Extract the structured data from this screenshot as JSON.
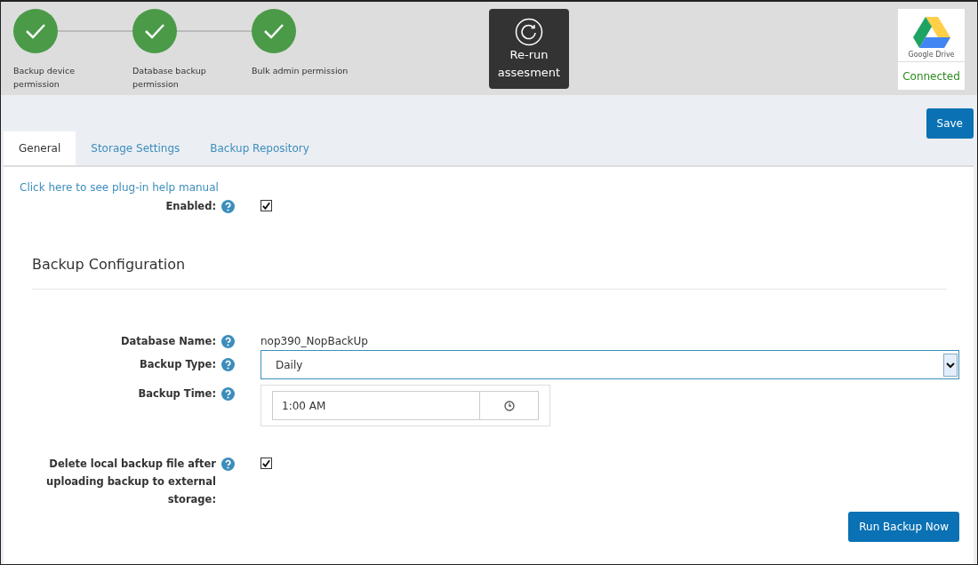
{
  "steps": [
    {
      "label": "Backup device permission",
      "completed": true
    },
    {
      "label": "Database backup permission",
      "completed": true
    },
    {
      "label": "Bulk admin permission",
      "completed": true
    }
  ],
  "rerun_button": {
    "label": "Re-run assesment"
  },
  "storage_card": {
    "name": "Google Drive",
    "status": "Connected"
  },
  "save_button": {
    "label": "Save"
  },
  "tabs": [
    {
      "label": "General",
      "selected": true
    },
    {
      "label": "Storage Settings",
      "selected": false
    },
    {
      "label": "Backup Repository",
      "selected": false
    }
  ],
  "help_link": "Click here to see plug-in help manual",
  "enabled": {
    "label": "Enabled:",
    "checked": true
  },
  "section_title": "Backup Configuration",
  "fields": [
    {
      "kind": "text",
      "label": "Database Name:",
      "value": "nop390_NopBackUp"
    },
    {
      "kind": "select",
      "label": "Backup Type:",
      "value": "Daily"
    },
    {
      "kind": "time",
      "label": "Backup Time:",
      "value": "1:00 AM"
    },
    {
      "kind": "checkbox",
      "label": "Delete local backup file after uploading backup to external storage:",
      "checked": true
    }
  ],
  "run_button": {
    "label": "Run Backup Now"
  }
}
